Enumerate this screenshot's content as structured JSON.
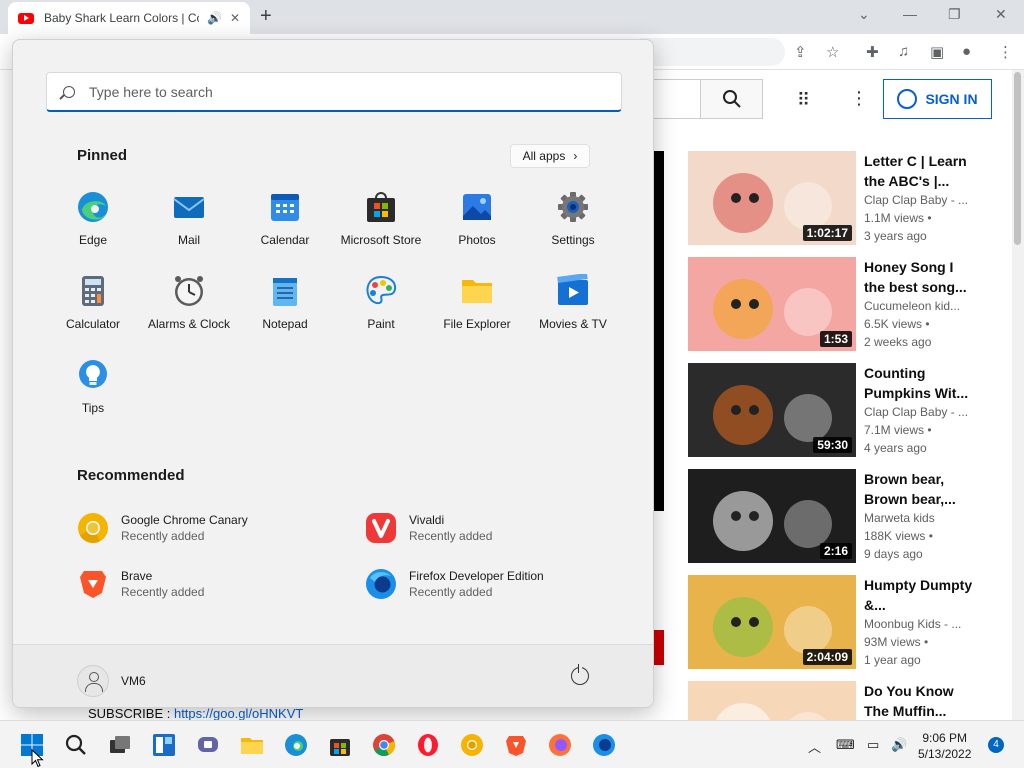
{
  "browser": {
    "tab_title": "Baby Shark Learn Colors | Co",
    "new_tab": "+",
    "window_controls": [
      "⌄",
      "—",
      "❐",
      "✕"
    ]
  },
  "youtube": {
    "sign_in": "SIGN IN",
    "subscribe_label": "SUBSCRIBE : ",
    "subscribe_link": "https://goo.gl/oHNKVT",
    "videos": [
      {
        "title": "Letter C | Learn the ABC's |...",
        "channel": "Clap Clap Baby - ...",
        "views": "1.1M views •",
        "age": "3 years ago",
        "duration": "1:02:17",
        "bg": "#f3d9c9",
        "accent": "#d9534f"
      },
      {
        "title": "Honey Song I the best song...",
        "channel": "Cucumeleon kid...",
        "views": "6.5K views •",
        "age": "2 weeks ago",
        "duration": "1:53",
        "bg": "#f4a6a3",
        "accent": "#f2a51a"
      },
      {
        "title": "Counting Pumpkins Wit...",
        "channel": "Clap Clap Baby - ...",
        "views": "7.1M views •",
        "age": "4 years ago",
        "duration": "59:30",
        "bg": "#2b2b2b",
        "accent": "#e56a1c"
      },
      {
        "title": "Brown bear, Brown bear,...",
        "channel": "Marweta kids",
        "views": "188K views •",
        "age": "9 days ago",
        "duration": "2:16",
        "bg": "#1e1e1e",
        "accent": "#ffffff"
      },
      {
        "title": "Humpty Dumpty &...",
        "channel": "Moonbug Kids - ...",
        "views": "93M views •",
        "age": "1 year ago",
        "duration": "2:04:09",
        "bg": "#e8b34a",
        "accent": "#7cc242"
      },
      {
        "title": "Do You Know The Muffin...",
        "channel": "",
        "views": "",
        "age": "",
        "duration": "",
        "bg": "#f6d7b8",
        "accent": "#ffffff"
      }
    ]
  },
  "start_menu": {
    "search_placeholder": "Type here to search",
    "pinned_title": "Pinned",
    "all_apps": "All apps",
    "all_apps_chevron": "›",
    "pinned": [
      {
        "label": "Edge",
        "icon": "edge-icon"
      },
      {
        "label": "Mail",
        "icon": "mail-icon"
      },
      {
        "label": "Calendar",
        "icon": "calendar-icon"
      },
      {
        "label": "Microsoft Store",
        "icon": "store-icon"
      },
      {
        "label": "Photos",
        "icon": "photos-icon"
      },
      {
        "label": "Settings",
        "icon": "settings-icon"
      },
      {
        "label": "Calculator",
        "icon": "calculator-icon"
      },
      {
        "label": "Alarms & Clock",
        "icon": "clock-icon"
      },
      {
        "label": "Notepad",
        "icon": "notepad-icon"
      },
      {
        "label": "Paint",
        "icon": "paint-icon"
      },
      {
        "label": "File Explorer",
        "icon": "folder-icon"
      },
      {
        "label": "Movies & TV",
        "icon": "movies-icon"
      },
      {
        "label": "Tips",
        "icon": "tips-icon"
      }
    ],
    "recommended_title": "Recommended",
    "recommended": [
      {
        "name": "Google Chrome Canary",
        "sub": "Recently added",
        "icon": "chrome-canary-icon"
      },
      {
        "name": "Vivaldi",
        "sub": "Recently added",
        "icon": "vivaldi-icon"
      },
      {
        "name": "Brave",
        "sub": "Recently added",
        "icon": "brave-icon"
      },
      {
        "name": "Firefox Developer Edition",
        "sub": "Recently added",
        "icon": "firefox-dev-icon"
      }
    ],
    "user_name": "VM6"
  },
  "taskbar": {
    "time": "9:06 PM",
    "date": "5/13/2022",
    "notification_count": "4"
  }
}
